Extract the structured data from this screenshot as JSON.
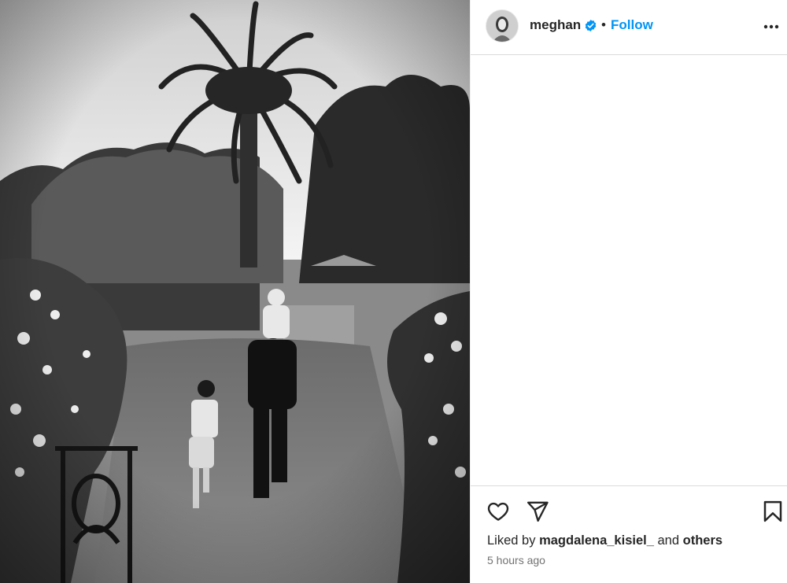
{
  "post": {
    "image_alt": "Black and white garden photo",
    "author": {
      "username": "meghan",
      "verified": true,
      "separator": "•",
      "follow_label": "Follow"
    },
    "likes": {
      "prefix": "Liked by",
      "user": "magdalena_kisiel_",
      "connector": "and",
      "others": "others"
    },
    "timestamp": "5 hours ago"
  },
  "colors": {
    "accent": "#0095f6",
    "text": "#262626",
    "secondary": "#737373",
    "border": "#dbdbdb"
  },
  "icons": {
    "verified": "verified-badge-icon",
    "more": "more-options-icon",
    "like": "heart-icon",
    "share": "send-icon",
    "save": "bookmark-icon"
  }
}
